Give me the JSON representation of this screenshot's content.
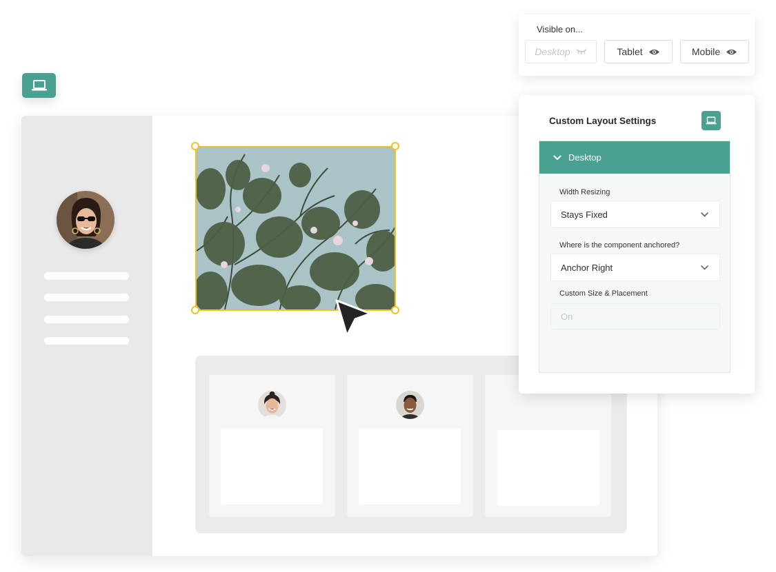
{
  "visible_on": {
    "title": "Visible on...",
    "buttons": [
      {
        "label": "Desktop",
        "state": "hidden",
        "icon": "eye-closed-icon"
      },
      {
        "label": "Tablet",
        "state": "visible",
        "icon": "eye-icon"
      },
      {
        "label": "Mobile",
        "state": "visible",
        "icon": "eye-icon"
      }
    ]
  },
  "settings": {
    "title": "Custom Layout Settings",
    "section": "Desktop",
    "fields": [
      {
        "label": "Width Resizing",
        "value": "Stays Fixed"
      },
      {
        "label": "Where is the component anchored?",
        "value": "Anchor Right"
      },
      {
        "label": "Custom Size & Placement",
        "value": "On"
      }
    ]
  },
  "colors": {
    "accent": "#4aa191",
    "selection": "#f2c01f",
    "sidebar": "#e9e9e9"
  }
}
